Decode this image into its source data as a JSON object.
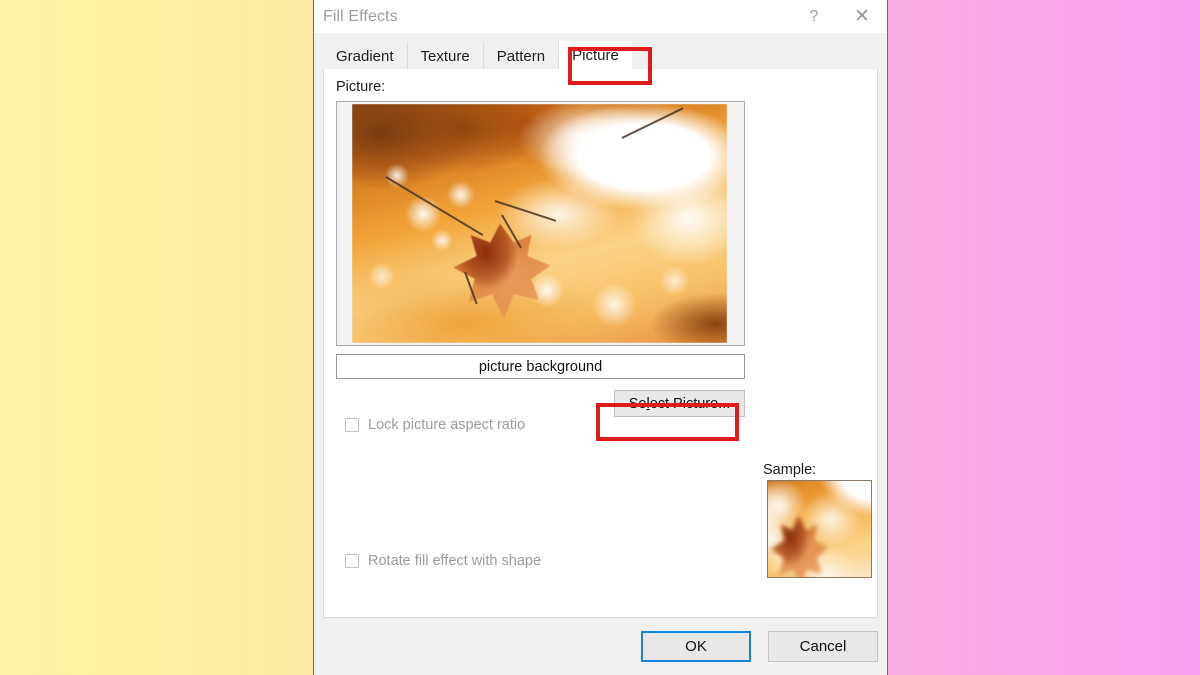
{
  "window": {
    "title": "Fill Effects",
    "help_icon": "question-mark-icon",
    "close_icon": "close-icon"
  },
  "tabs": [
    {
      "label": "Gradient",
      "active": false
    },
    {
      "label": "Texture",
      "active": false
    },
    {
      "label": "Pattern",
      "active": false
    },
    {
      "label": "Picture",
      "active": true
    }
  ],
  "picture_tab": {
    "picture_label": "Picture:",
    "filename_value": "picture background",
    "select_picture_label_pre": "Se",
    "select_picture_accel": "l",
    "select_picture_label_post": "ect Picture...",
    "lock_aspect_label": "Lock picture aspect ratio",
    "lock_aspect_checked": false,
    "lock_aspect_enabled": false,
    "rotate_fill_label": "Rotate fill effect with shape",
    "rotate_fill_checked": false,
    "rotate_fill_enabled": false,
    "sample_label": "Sample:",
    "preview_image_description": "autumn maple leaves with bokeh highlights"
  },
  "footer": {
    "ok_label": "OK",
    "cancel_label": "Cancel"
  },
  "annotations": [
    {
      "target": "picture-tab",
      "color": "#e01b1b"
    },
    {
      "target": "select-picture",
      "color": "#e01b1b"
    }
  ],
  "colors": {
    "accent_focus": "#1683d8",
    "annotation_red": "#e01b1b",
    "dialog_face": "#f0f0f0",
    "panel_white": "#ffffff",
    "disabled_text": "#9b9b9b",
    "title_text": "#9d9d9d",
    "background_gradient_start": "#fbf4a4",
    "background_gradient_end": "#fb9ff0"
  }
}
